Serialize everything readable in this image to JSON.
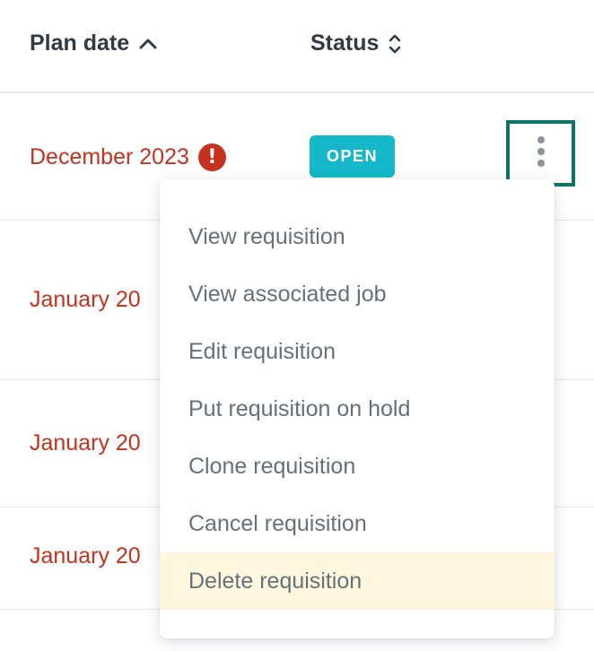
{
  "table": {
    "headers": {
      "plan_date": "Plan date",
      "status": "Status"
    },
    "rows": [
      {
        "plan_date": "December 2023",
        "warning": "!",
        "status": "OPEN"
      },
      {
        "plan_date": "January 20"
      },
      {
        "plan_date": "January 20"
      },
      {
        "plan_date": "January 20"
      }
    ]
  },
  "menu": {
    "items": [
      "View requisition",
      "View associated job",
      "Edit requisition",
      "Put requisition on hold",
      "Clone requisition",
      "Cancel requisition",
      "Delete requisition"
    ],
    "highlighted_item": "Delete requisition"
  },
  "colors": {
    "date_red": "#c6321f",
    "status_open": "#14b8c8",
    "focus_ring": "#0b7566",
    "highlight": "#fef7dd",
    "header_text": "#303a47",
    "menu_text": "#66707c"
  },
  "icons": {
    "sort_ascending": "chevron-up-icon",
    "sort_both": "sort-updown-icon",
    "warning": "exclamation-circle-icon",
    "more_actions": "kebab-vertical-icon"
  }
}
